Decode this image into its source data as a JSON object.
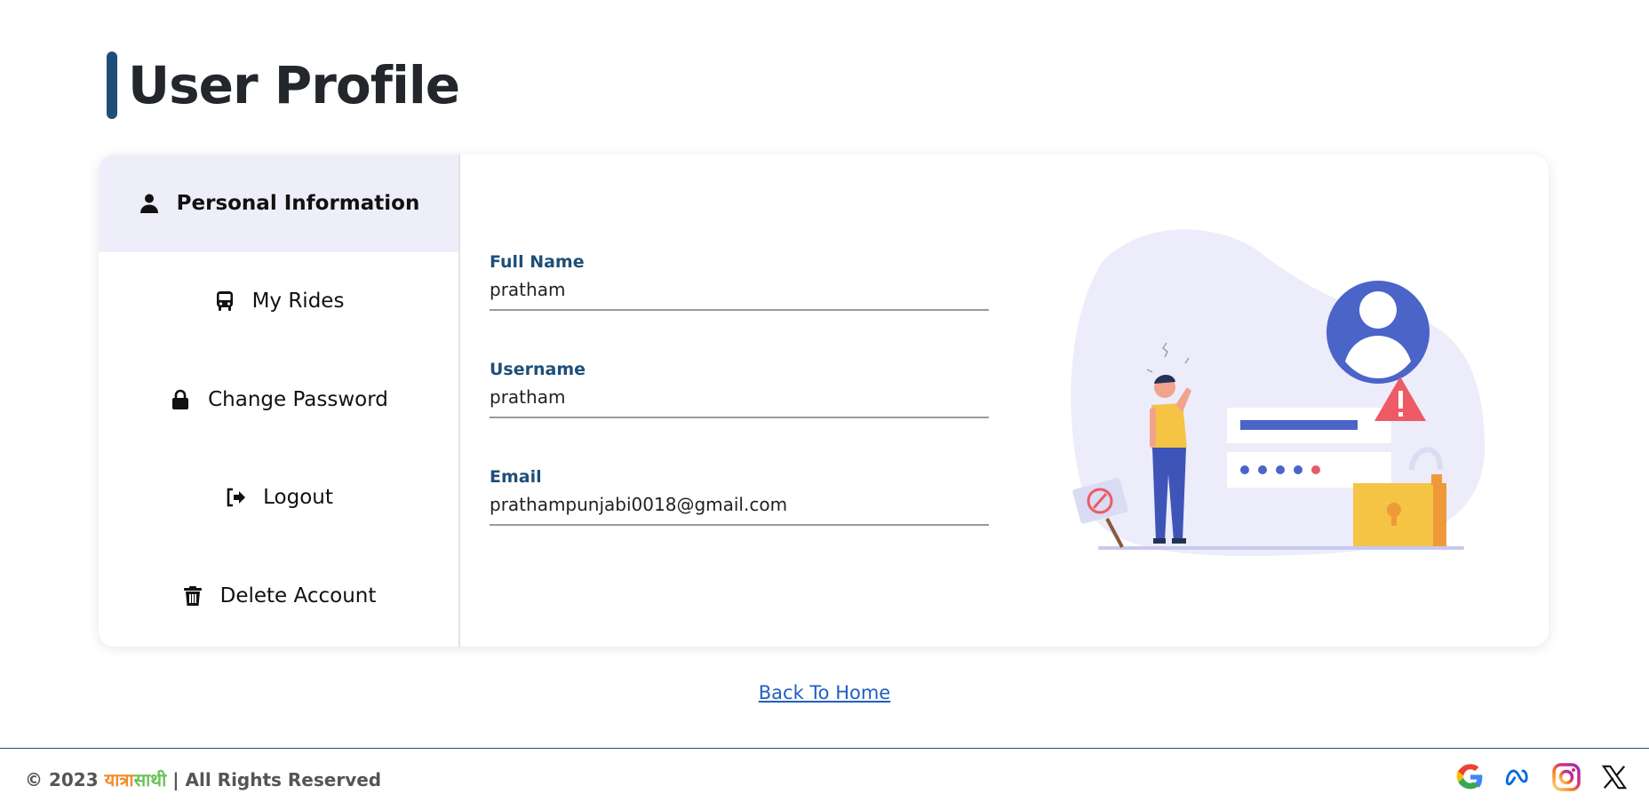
{
  "page": {
    "title": "User Profile"
  },
  "sidebar": {
    "items": [
      {
        "label": "Personal Information",
        "icon": "user-icon",
        "active": true
      },
      {
        "label": "My Rides",
        "icon": "bus-icon",
        "active": false
      },
      {
        "label": "Change Password",
        "icon": "lock-icon",
        "active": false
      },
      {
        "label": "Logout",
        "icon": "logout-icon",
        "active": false
      },
      {
        "label": "Delete Account",
        "icon": "trash-icon",
        "active": false
      }
    ]
  },
  "form": {
    "full_name": {
      "label": "Full Name",
      "value": "pratham"
    },
    "username": {
      "label": "Username",
      "value": "pratham"
    },
    "email": {
      "label": "Email",
      "value": "prathampunjabi0018@gmail.com"
    }
  },
  "illustration": {
    "name": "forgot-password-illustration"
  },
  "links": {
    "back_home": "Back To Home"
  },
  "footer": {
    "copyright_prefix": "© 2023",
    "brand_part1": "यात्रा",
    "brand_part2": "साथी",
    "rights": "| All Rights Reserved",
    "socials": [
      "google-icon",
      "meta-icon",
      "instagram-icon",
      "x-icon"
    ]
  },
  "colors": {
    "accent": "#1f4e79",
    "active_tab_bg": "#eeeefb",
    "link": "#1f5fbf",
    "brand_orange": "#f28c28",
    "brand_green": "#6ac259"
  }
}
